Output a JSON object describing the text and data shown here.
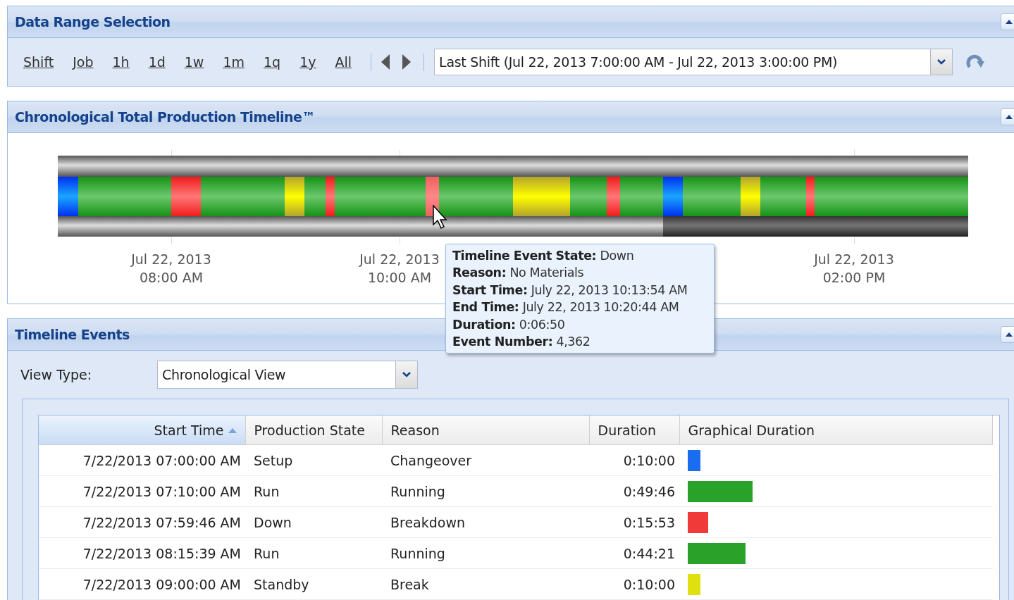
{
  "range_panel": {
    "title": "Data Range Selection",
    "collapsed": false,
    "range_links": [
      "Shift",
      "Job",
      "1h",
      "1d",
      "1w",
      "1m",
      "1q",
      "1y",
      "All"
    ],
    "range_field": {
      "value": "Last Shift (Jul 22, 2013 7:00:00 AM - Jul 22, 2013 3:00:00 PM)"
    }
  },
  "timeline_panel": {
    "title": "Chronological Total Production Timeline™",
    "collapsed": false,
    "ticks": [
      {
        "date": "Jul 22, 2013",
        "time": "08:00 AM"
      },
      {
        "date": "Jul 22, 2013",
        "time": "10:00 AM"
      },
      {
        "date": "Jul 22, 2013",
        "time": "02:00 PM"
      }
    ],
    "tooltip": [
      "**Timeline Event State:** Down",
      "**Reason:** No Materials",
      "**Start Time:** July 22, 2013 10:13:54 AM",
      "**End Time:** July 22, 2013 10:20:44 AM",
      "**Duration:** 0:06:50",
      "**Event Number:** 4,362"
    ]
  },
  "events_panel": {
    "title": "Timeline Events",
    "collapsed": false,
    "view_type": {
      "label": "View Type:",
      "value": "Chronological View"
    },
    "table": {
      "columns": [
        {
          "label": "Start Time",
          "sorted": true
        },
        {
          "label": "Production State",
          "sorted": false
        },
        {
          "label": "Reason",
          "sorted": false
        },
        {
          "label": "Duration",
          "sorted": false
        },
        {
          "label": "Graphical Duration",
          "sorted": false
        }
      ],
      "rows": [
        {
          "start": "7/22/2013 07:00:00 AM",
          "state": "Setup",
          "reason": "Changeover",
          "duration": "0:10:00",
          "color": "#1a6cf0"
        },
        {
          "start": "7/22/2013 07:10:00 AM",
          "state": "Run",
          "reason": "Running",
          "duration": "0:49:46",
          "color": "#2aa22a"
        },
        {
          "start": "7/22/2013 07:59:46 AM",
          "state": "Down",
          "reason": "Breakdown",
          "duration": "0:15:53",
          "color": "#f03a3a"
        },
        {
          "start": "7/22/2013 08:15:39 AM",
          "state": "Run",
          "reason": "Running",
          "duration": "0:44:21",
          "color": "#2aa22a"
        },
        {
          "start": "7/22/2013 09:00:00 AM",
          "state": "Standby",
          "reason": "Break",
          "duration": "0:10:00",
          "color": "#e0e010"
        }
      ]
    }
  }
}
